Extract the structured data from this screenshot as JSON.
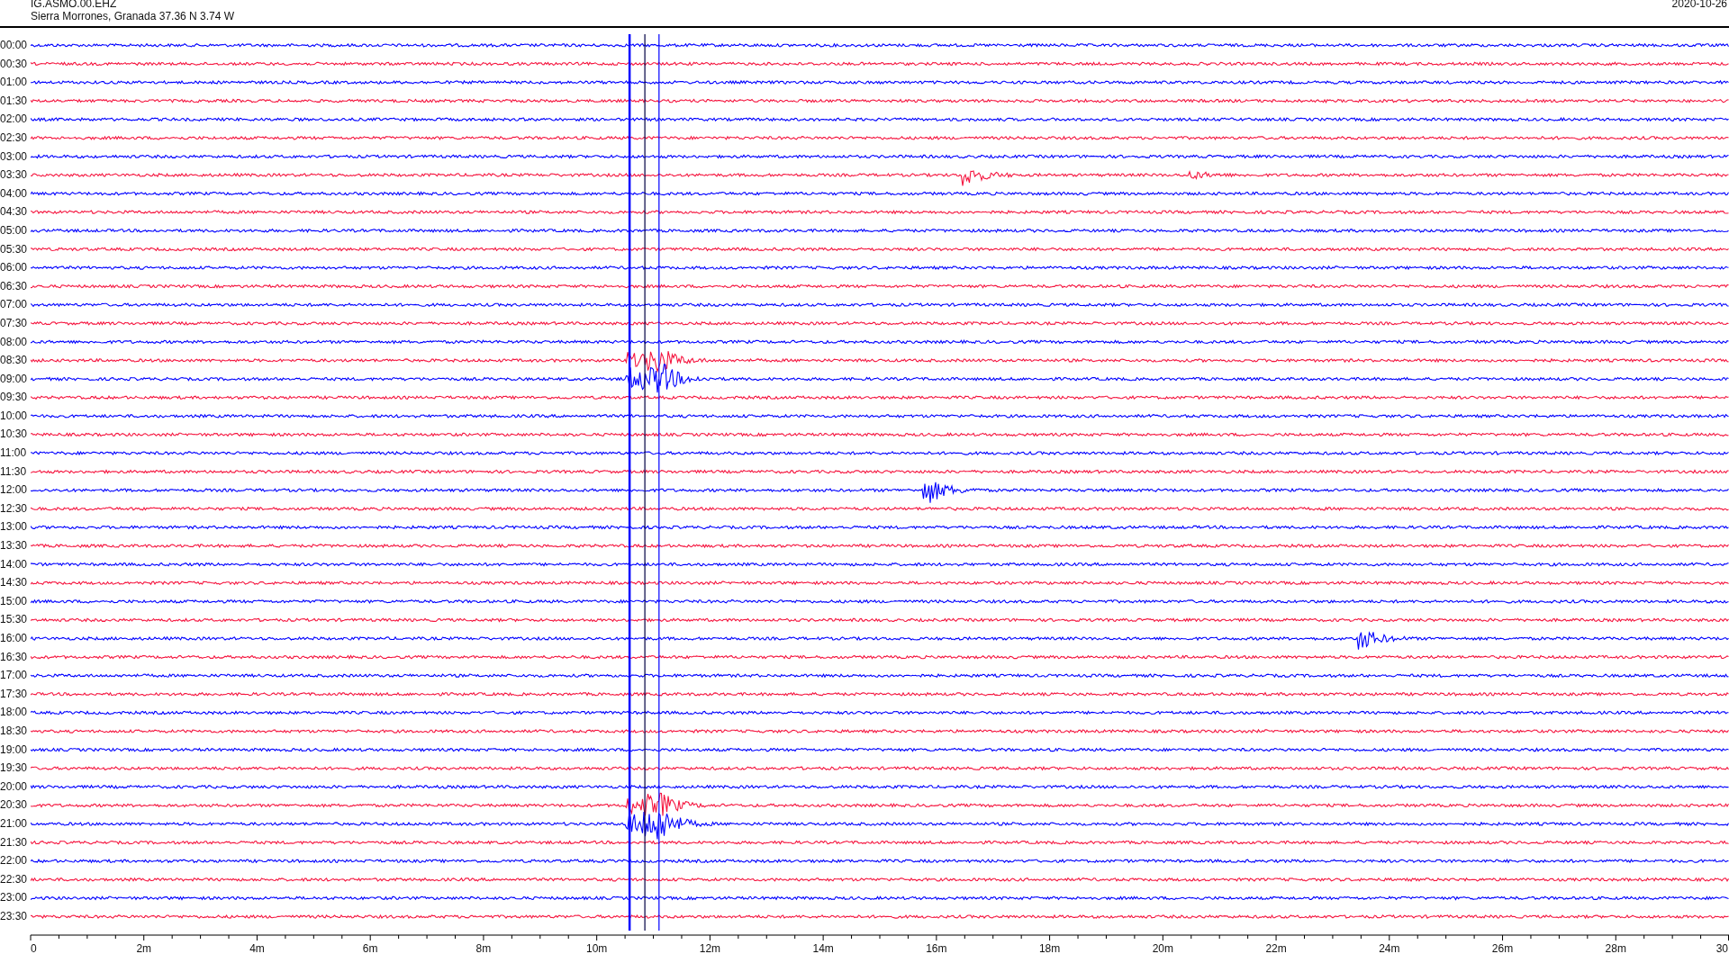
{
  "header": {
    "station": "IG.ASMO.00.EHZ",
    "location": "Sierra Morrones, Granada  37.36 N 3.74 W",
    "date": "2020-10-26"
  },
  "rows": [
    {
      "time": "00:00",
      "color": "#0000ff"
    },
    {
      "time": "00:30",
      "color": "#f5153f"
    },
    {
      "time": "01:00",
      "color": "#0000ff"
    },
    {
      "time": "01:30",
      "color": "#f5153f"
    },
    {
      "time": "02:00",
      "color": "#0000ff"
    },
    {
      "time": "02:30",
      "color": "#f5153f"
    },
    {
      "time": "03:00",
      "color": "#0000ff"
    },
    {
      "time": "03:30",
      "color": "#f5153f"
    },
    {
      "time": "04:00",
      "color": "#0000ff"
    },
    {
      "time": "04:30",
      "color": "#f5153f"
    },
    {
      "time": "05:00",
      "color": "#0000ff"
    },
    {
      "time": "05:30",
      "color": "#f5153f"
    },
    {
      "time": "06:00",
      "color": "#0000ff"
    },
    {
      "time": "06:30",
      "color": "#f5153f"
    },
    {
      "time": "07:00",
      "color": "#0000ff"
    },
    {
      "time": "07:30",
      "color": "#f5153f"
    },
    {
      "time": "08:00",
      "color": "#0000ff"
    },
    {
      "time": "08:30",
      "color": "#f5153f"
    },
    {
      "time": "09:00",
      "color": "#0000ff"
    },
    {
      "time": "09:30",
      "color": "#f5153f"
    },
    {
      "time": "10:00",
      "color": "#0000ff"
    },
    {
      "time": "10:30",
      "color": "#f5153f"
    },
    {
      "time": "11:00",
      "color": "#0000ff"
    },
    {
      "time": "11:30",
      "color": "#f5153f"
    },
    {
      "time": "12:00",
      "color": "#0000ff"
    },
    {
      "time": "12:30",
      "color": "#f5153f"
    },
    {
      "time": "13:00",
      "color": "#0000ff"
    },
    {
      "time": "13:30",
      "color": "#f5153f"
    },
    {
      "time": "14:00",
      "color": "#0000ff"
    },
    {
      "time": "14:30",
      "color": "#f5153f"
    },
    {
      "time": "15:00",
      "color": "#0000ff"
    },
    {
      "time": "15:30",
      "color": "#f5153f"
    },
    {
      "time": "16:00",
      "color": "#0000ff"
    },
    {
      "time": "16:30",
      "color": "#f5153f"
    },
    {
      "time": "17:00",
      "color": "#0000ff"
    },
    {
      "time": "17:30",
      "color": "#f5153f"
    },
    {
      "time": "18:00",
      "color": "#0000ff"
    },
    {
      "time": "18:30",
      "color": "#f5153f"
    },
    {
      "time": "19:00",
      "color": "#0000ff"
    },
    {
      "time": "19:30",
      "color": "#f5153f"
    },
    {
      "time": "20:00",
      "color": "#0000ff"
    },
    {
      "time": "20:30",
      "color": "#f5153f"
    },
    {
      "time": "21:00",
      "color": "#0000ff"
    },
    {
      "time": "21:30",
      "color": "#f5153f"
    },
    {
      "time": "22:00",
      "color": "#0000ff"
    },
    {
      "time": "22:30",
      "color": "#f5153f"
    },
    {
      "time": "23:00",
      "color": "#0000ff"
    },
    {
      "time": "23:30",
      "color": "#f5153f"
    }
  ],
  "x_axis": {
    "labels": [
      "0",
      "2m",
      "4m",
      "6m",
      "8m",
      "10m",
      "12m",
      "14m",
      "16m",
      "18m",
      "20m",
      "22m",
      "24m",
      "26m",
      "28m",
      "30"
    ]
  }
}
